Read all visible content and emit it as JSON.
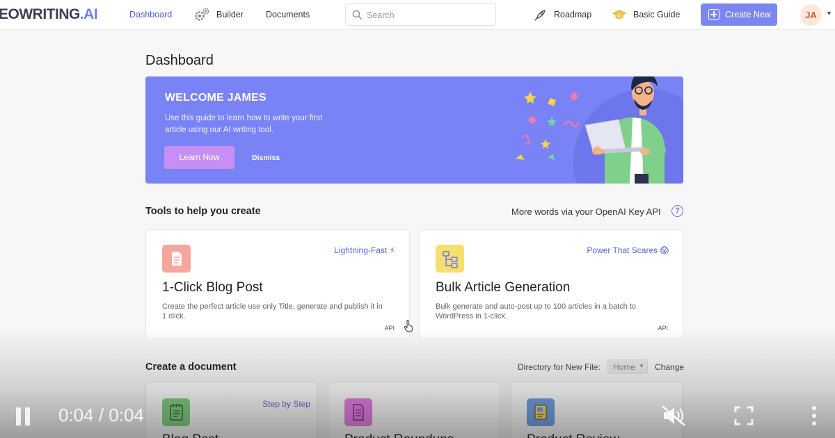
{
  "nav": {
    "logo_main": "EOWRITING",
    "logo_suffix": ".AI",
    "dashboard": "Dashboard",
    "builder": "Builder",
    "documents": "Documents",
    "search_placeholder": "Search",
    "roadmap": "Roadmap",
    "basic_guide": "Basic Guide",
    "create_new": "Create New",
    "avatar_initials": "JA"
  },
  "page": {
    "title": "Dashboard"
  },
  "banner": {
    "heading": "WELCOME JAMES",
    "description": "Use this guide to learn how to write your first article using our AI writing tool.",
    "learn_button": "Learn Now",
    "dismiss_button": "Dismiss"
  },
  "tools": {
    "section_title": "Tools to help you create",
    "api_link": "More words via your OpenAI Key API",
    "cards": [
      {
        "badge": "Lightning-Fast",
        "badge_icon": "⚡",
        "title": "1-Click Blog Post",
        "description": "Create the perfect article use only Title, generate and publish it in 1 click.",
        "tag": "API",
        "icon": "document-icon",
        "icon_color": "#f5a79f"
      },
      {
        "badge": "Power That Scares",
        "badge_icon": "😱",
        "title": "Bulk Article Generation",
        "description": "Bulk generate and auto-post up to 100 articles in a batch to WordPress in 1-click.",
        "tag": "API",
        "icon": "flowchart-icon",
        "icon_color": "#f7df6f"
      }
    ]
  },
  "documents": {
    "section_title": "Create a document",
    "directory_label": "Directory for New File:",
    "directory_value": "Home",
    "change_link": "Change",
    "cards": [
      {
        "title": "Blog Post",
        "badge": "Step by Step",
        "icon": "notebook-icon",
        "icon_color": "#7fd17f"
      },
      {
        "title": "Product Roundups",
        "badge": "",
        "icon": "list-document-icon",
        "icon_color": "#e87be6"
      },
      {
        "title": "Product Review",
        "badge": "",
        "icon": "review-document-icon",
        "icon_color": "#6f9fe8"
      }
    ]
  },
  "video": {
    "time": "0:04 / 0:04"
  }
}
